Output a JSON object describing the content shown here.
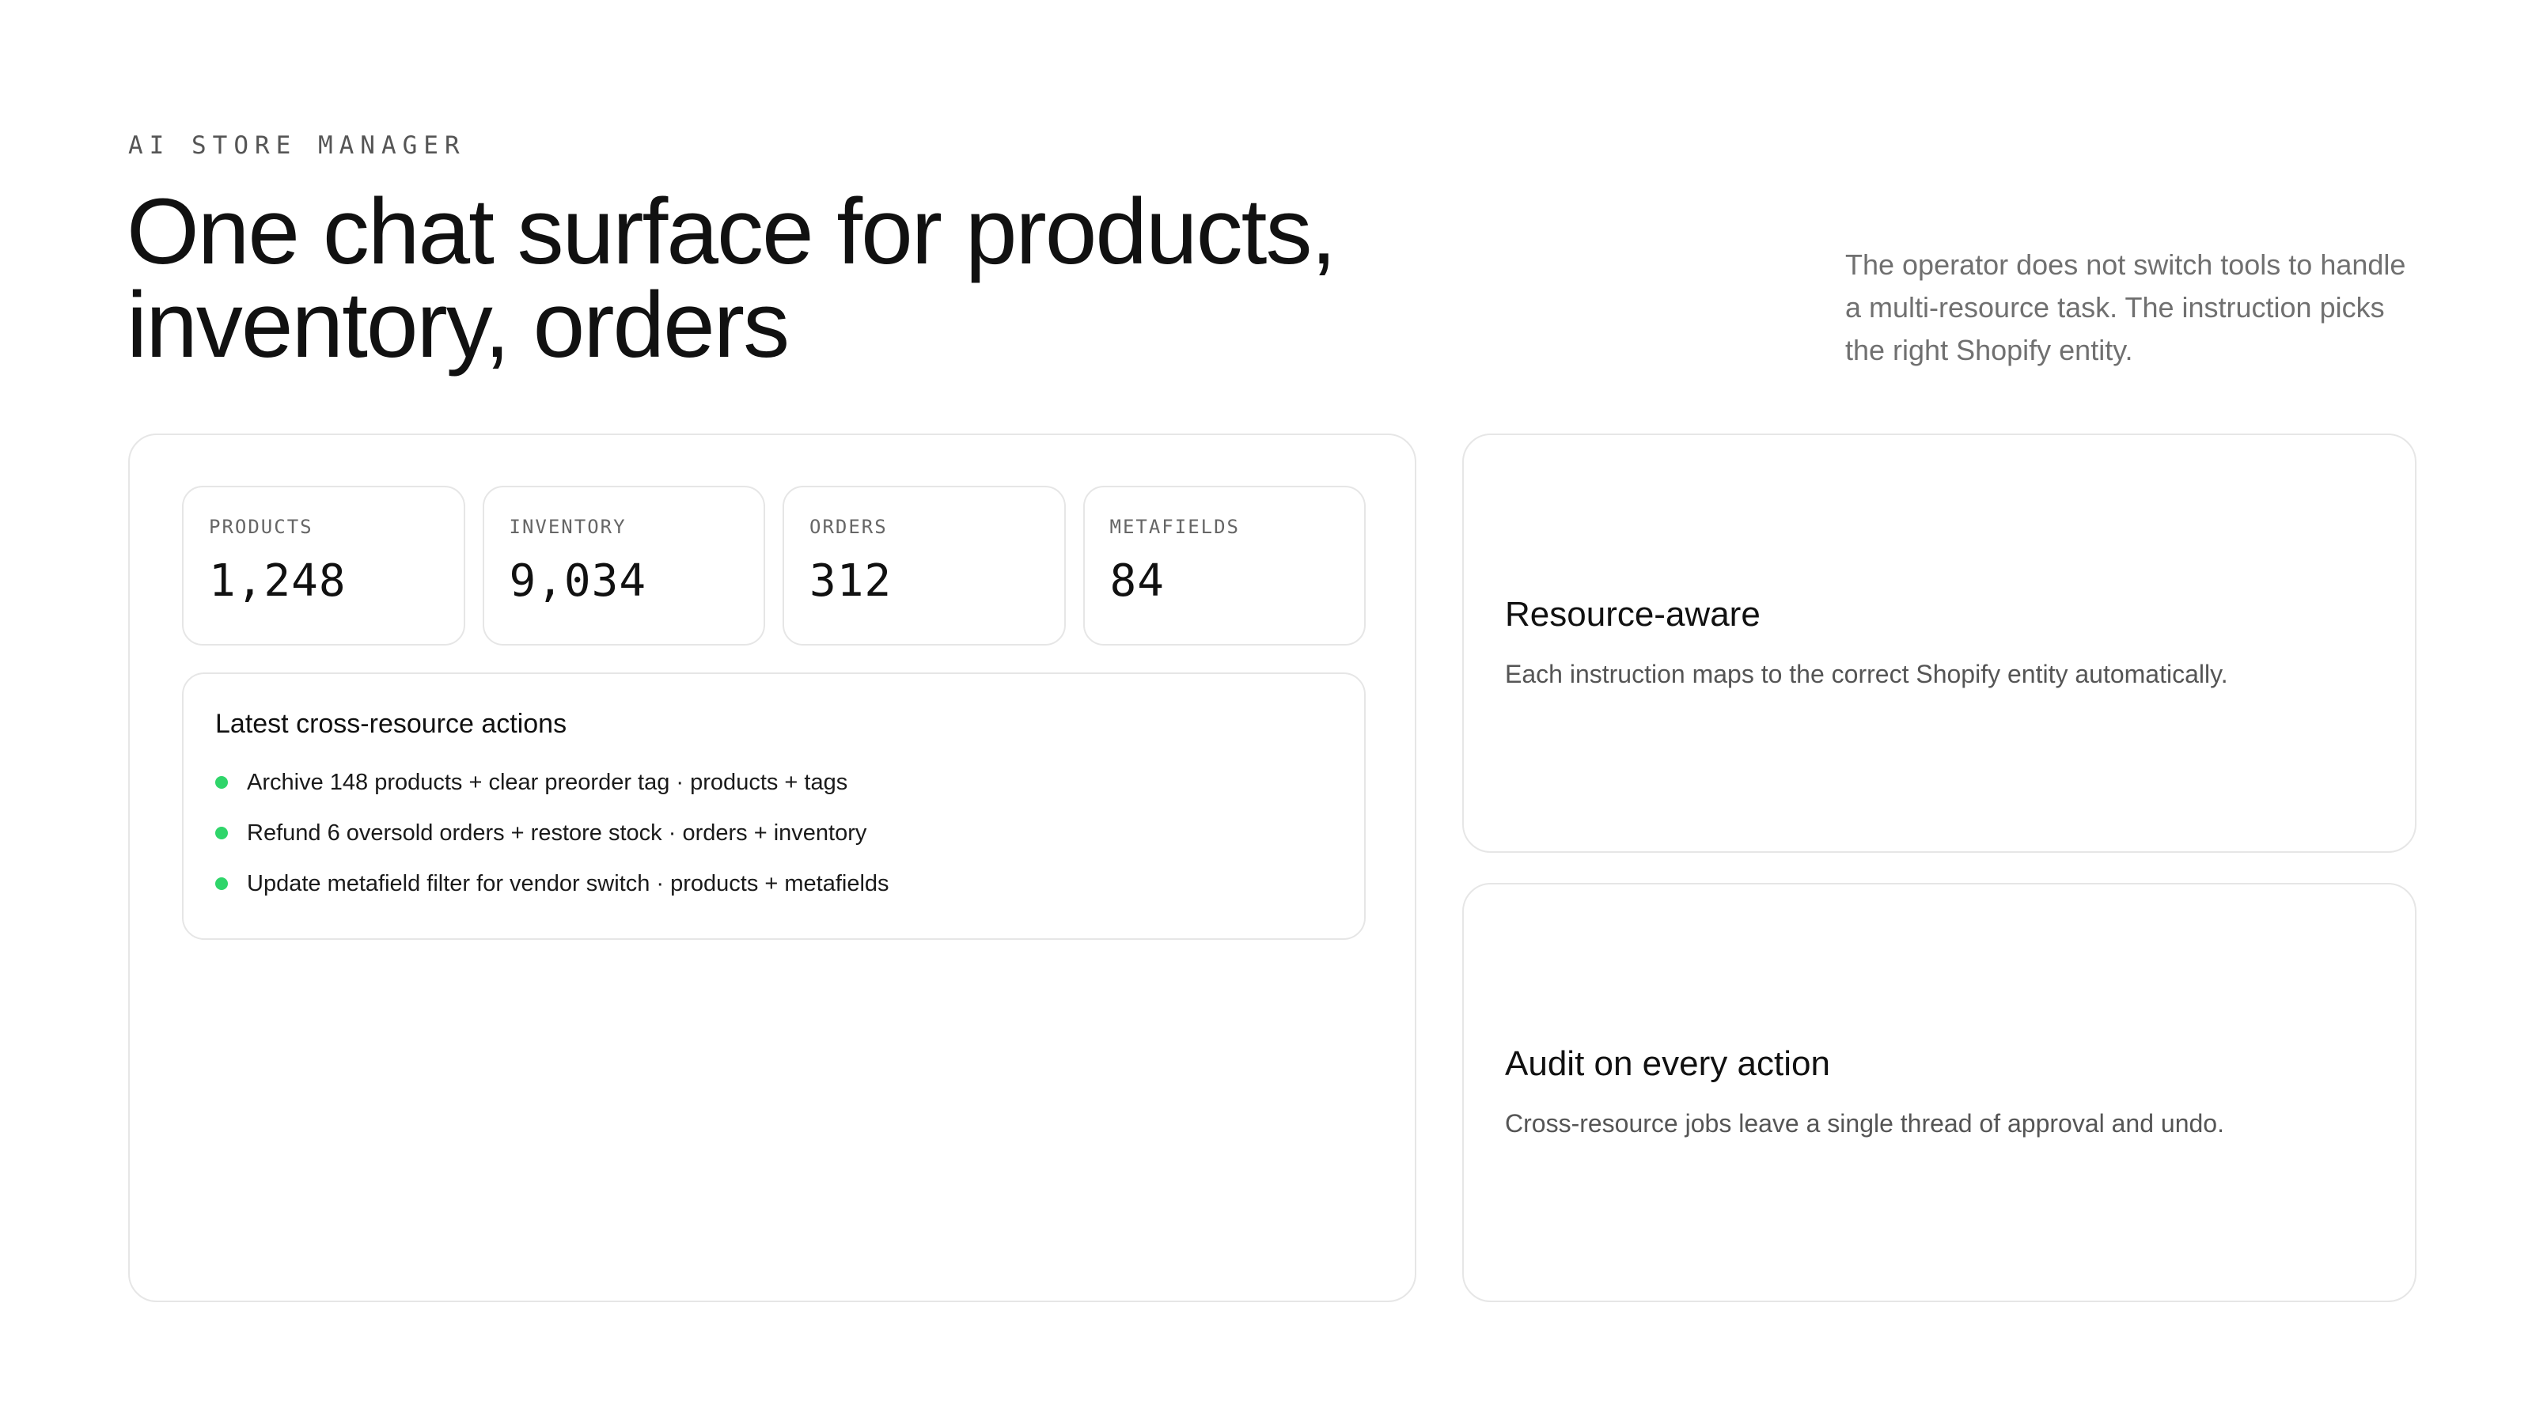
{
  "header": {
    "eyebrow": "AI STORE MANAGER",
    "headline_line1": "One chat surface for products,",
    "headline_line2": "inventory, orders",
    "side_note": "The operator does not switch tools to handle a multi-resource task. The instruction picks the right Shopify entity."
  },
  "stats": [
    {
      "label": "PRODUCTS",
      "value": "1,248"
    },
    {
      "label": "INVENTORY",
      "value": "9,034"
    },
    {
      "label": "ORDERS",
      "value": "312"
    },
    {
      "label": "METAFIELDS",
      "value": "84"
    }
  ],
  "actions": {
    "title": "Latest cross-resource actions",
    "items": [
      "Archive 148 products + clear preorder tag · products + tags",
      "Refund 6 oversold orders + restore stock · orders + inventory",
      "Update metafield filter for vendor switch · products + metafields"
    ],
    "status_color": "#2fd56a"
  },
  "features": [
    {
      "title": "Resource-aware",
      "description": "Each instruction maps to the correct Shopify entity automatically."
    },
    {
      "title": "Audit on every action",
      "description": "Cross-resource jobs leave a single thread of approval and undo."
    }
  ]
}
